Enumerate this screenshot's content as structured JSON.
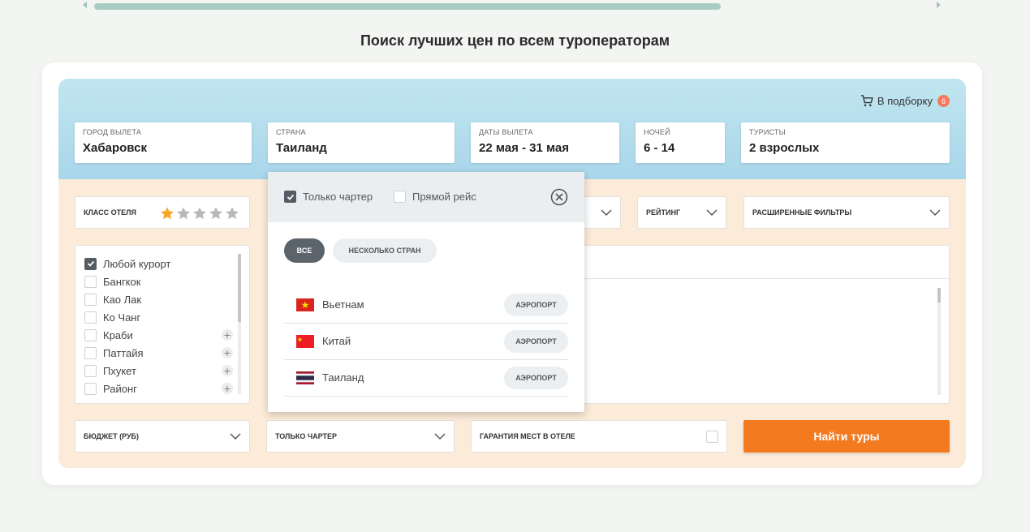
{
  "page_title": "Поиск лучших цен по всем туроператорам",
  "cart": {
    "label": "В подборку",
    "count": "6"
  },
  "fields": {
    "departure": {
      "label": "ГОРОД ВЫЛЕТА",
      "value": "Хабаровск"
    },
    "country": {
      "label": "СТРАНА",
      "value": "Таиланд"
    },
    "dates": {
      "label": "ДАТЫ ВЫЛЕТА",
      "value": "22 мая - 31 мая"
    },
    "nights": {
      "label": "НОЧЕЙ",
      "value": "6 - 14"
    },
    "tourists": {
      "label": "ТУРИСТЫ",
      "value": "2 взрослых"
    }
  },
  "filters": {
    "hotel_class": {
      "label": "КЛАСС ОТЕЛЯ",
      "rating": 1,
      "max": 5
    },
    "rating": {
      "label": "РЕЙТИНГ"
    },
    "advanced": {
      "label": "РАСШИРЕННЫЕ ФИЛЬТРЫ"
    }
  },
  "resorts": [
    {
      "name": "Любой курорт",
      "checked": true,
      "expandable": false
    },
    {
      "name": "Бангкок",
      "checked": false,
      "expandable": false
    },
    {
      "name": "Као Лак",
      "checked": false,
      "expandable": false
    },
    {
      "name": "Ко Чанг",
      "checked": false,
      "expandable": false
    },
    {
      "name": "Краби",
      "checked": false,
      "expandable": true
    },
    {
      "name": "Паттайя",
      "checked": false,
      "expandable": true
    },
    {
      "name": "Пхукет",
      "checked": false,
      "expandable": true
    },
    {
      "name": "Районг",
      "checked": false,
      "expandable": true
    }
  ],
  "bottom": {
    "budget": {
      "label": "БЮДЖЕТ (РУБ)"
    },
    "charter": {
      "label": "ТОЛЬКО ЧАРТЕР"
    },
    "guarantee": {
      "label": "ГАРАНТИЯ МЕСТ В ОТЕЛЕ"
    },
    "search_button": "Найти туры"
  },
  "dropdown": {
    "charter_only": {
      "label": "Только чартер",
      "checked": true
    },
    "direct_flight": {
      "label": "Прямой рейс",
      "checked": false
    },
    "tabs": {
      "all": "ВСЕ",
      "multiple": "НЕСКОЛЬКО СТРАН"
    },
    "airport_label": "АЭРОПОРТ",
    "countries": [
      {
        "name": "Вьетнам",
        "flag": "vietnam"
      },
      {
        "name": "Китай",
        "flag": "china"
      },
      {
        "name": "Таиланд",
        "flag": "thailand"
      }
    ]
  },
  "colors": {
    "accent": "#f47a20",
    "badge": "#f27b5e",
    "star_active": "#f5a623",
    "star_inactive": "#b8b8b8"
  }
}
